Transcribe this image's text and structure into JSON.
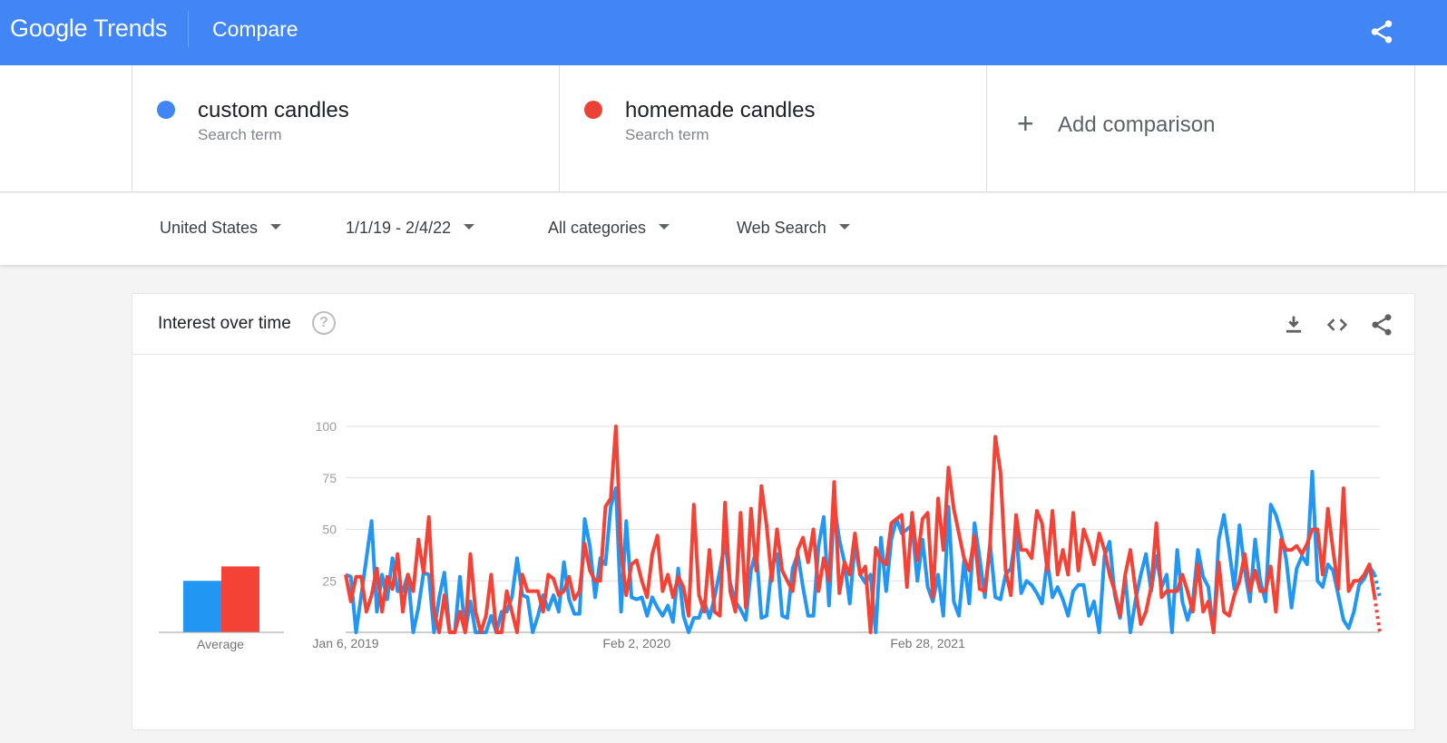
{
  "header": {
    "logo_google": "Google",
    "logo_trends": "Trends",
    "page_title": "Compare"
  },
  "terms": [
    {
      "name": "custom candles",
      "sub": "Search term",
      "color": "#4285f4"
    },
    {
      "name": "homemade candles",
      "sub": "Search term",
      "color": "#ea4335"
    }
  ],
  "add_comparison": {
    "plus": "+",
    "label": "Add comparison"
  },
  "filters": {
    "region": "United States",
    "date_range": "1/1/19 - 2/4/22",
    "category": "All categories",
    "search_type": "Web Search"
  },
  "card": {
    "title": "Interest over time",
    "help": "?",
    "average_label": "Average"
  },
  "chart_data": {
    "type": "line",
    "title": "Interest over time",
    "xlabel": "",
    "ylabel": "",
    "ylim": [
      0,
      100
    ],
    "yticks": [
      "100",
      "75",
      "50",
      "25"
    ],
    "x_tick_labels": [
      "Jan 6, 2019",
      "Feb 2, 2020",
      "Feb 28, 2021"
    ],
    "x_tick_indices": [
      0,
      56,
      112
    ],
    "grid": true,
    "averages": [
      {
        "name": "custom candles",
        "value": 25,
        "color": "#2196f3"
      },
      {
        "name": "homemade candles",
        "value": 32,
        "color": "#f44336"
      }
    ],
    "series": [
      {
        "name": "custom candles",
        "color": "#2196f3",
        "partial_last": true,
        "values": [
          28,
          27,
          0,
          18,
          36,
          54,
          10,
          28,
          16,
          36,
          20,
          20,
          28,
          0,
          12,
          29,
          28,
          0,
          17,
          29,
          0,
          0,
          27,
          0,
          15,
          0,
          0,
          0,
          8,
          0,
          10,
          10,
          17,
          36,
          18,
          17,
          0,
          8,
          18,
          11,
          18,
          10,
          34,
          16,
          9,
          9,
          55,
          42,
          17,
          36,
          33,
          61,
          70,
          10,
          54,
          17,
          16,
          17,
          8,
          17,
          12,
          8,
          13,
          5,
          31,
          8,
          0,
          7,
          7,
          15,
          7,
          17,
          30,
          44,
          24,
          15,
          11,
          6,
          30,
          40,
          7,
          8,
          32,
          38,
          8,
          7,
          31,
          38,
          22,
          8,
          8,
          42,
          56,
          13,
          62,
          45,
          34,
          14,
          43,
          28,
          24,
          28,
          0,
          46,
          20,
          45,
          55,
          48,
          50,
          52,
          25,
          45,
          22,
          15,
          28,
          8,
          61,
          15,
          8,
          35,
          14,
          53,
          36,
          17,
          43,
          17,
          16,
          28,
          31,
          48,
          19,
          25,
          23,
          19,
          14,
          35,
          17,
          22,
          16,
          8,
          20,
          23,
          23,
          8,
          15,
          0,
          37,
          44,
          18,
          7,
          27,
          0,
          16,
          28,
          38,
          20,
          37,
          22,
          28,
          0,
          40,
          15,
          6,
          15,
          40,
          27,
          22,
          0,
          45,
          57,
          40,
          21,
          52,
          30,
          15,
          45,
          25,
          15,
          62,
          57,
          48,
          35,
          12,
          31,
          37,
          33,
          78,
          25,
          22,
          33,
          30,
          18,
          6,
          2,
          10,
          23,
          26,
          32,
          28,
          17
        ]
      },
      {
        "name": "homemade candles",
        "color": "#f44336",
        "partial_last": true,
        "values": [
          28,
          15,
          27,
          27,
          10,
          18,
          31,
          10,
          27,
          21,
          38,
          10,
          28,
          20,
          45,
          29,
          56,
          10,
          0,
          18,
          0,
          0,
          10,
          0,
          38,
          10,
          0,
          8,
          28,
          0,
          0,
          20,
          10,
          0,
          28,
          20,
          20,
          20,
          10,
          28,
          26,
          18,
          20,
          27,
          16,
          20,
          43,
          30,
          25,
          25,
          61,
          65,
          100,
          40,
          18,
          33,
          35,
          25,
          17,
          38,
          47,
          20,
          28,
          17,
          27,
          22,
          8,
          62,
          18,
          10,
          40,
          10,
          8,
          63,
          20,
          10,
          58,
          12,
          60,
          30,
          71,
          52,
          25,
          50,
          30,
          25,
          20,
          40,
          46,
          34,
          50,
          20,
          36,
          25,
          73,
          19,
          34,
          28,
          48,
          28,
          32,
          0,
          41,
          35,
          33,
          53,
          55,
          57,
          22,
          58,
          35,
          55,
          58,
          17,
          65,
          40,
          80,
          60,
          48,
          36,
          30,
          47,
          21,
          20,
          43,
          95,
          78,
          30,
          18,
          57,
          40,
          40,
          36,
          59,
          53,
          30,
          59,
          28,
          40,
          28,
          58,
          30,
          50,
          43,
          33,
          48,
          40,
          28,
          20,
          8,
          28,
          40,
          20,
          4,
          10,
          22,
          53,
          17,
          20,
          20,
          20,
          28,
          20,
          10,
          33,
          10,
          15,
          0,
          34,
          10,
          8,
          18,
          25,
          38,
          20,
          30,
          20,
          20,
          32,
          10,
          45,
          40,
          40,
          42,
          38,
          43,
          50,
          50,
          28,
          60,
          40,
          21,
          70,
          20,
          25,
          25,
          28,
          33,
          17,
          0
        ]
      }
    ]
  }
}
